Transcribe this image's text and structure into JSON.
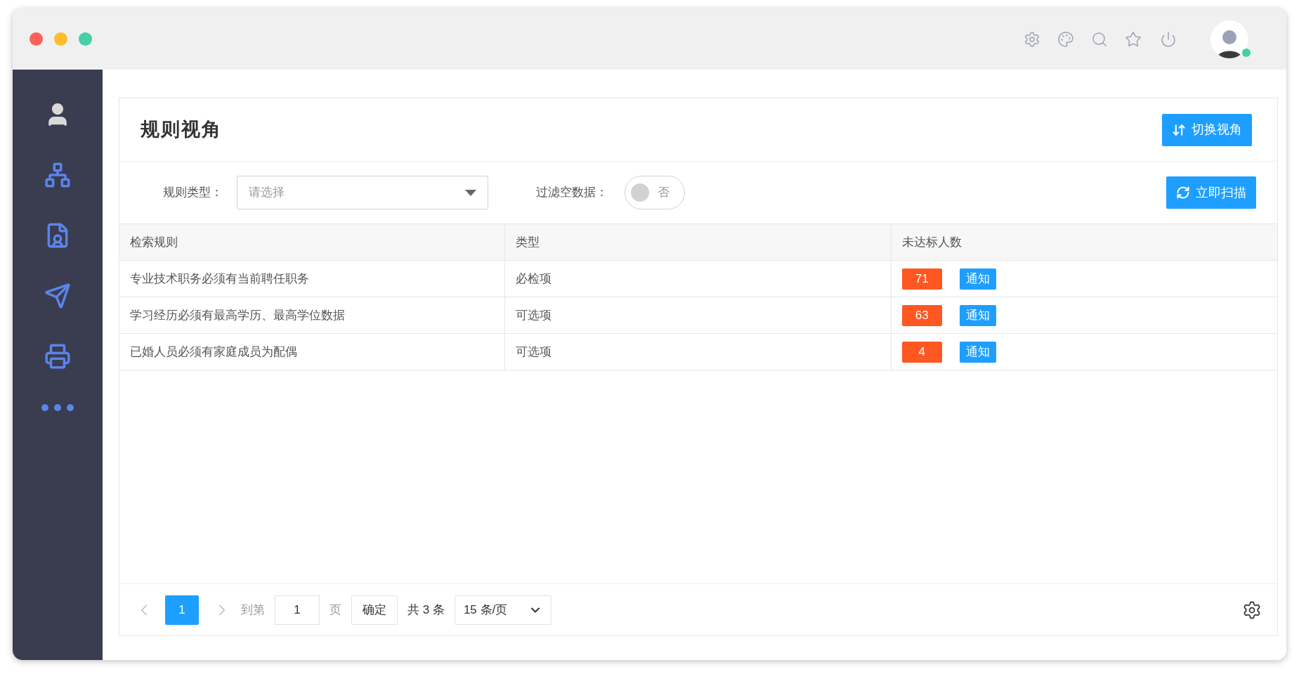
{
  "user": {
    "online": true
  },
  "sidebar": {
    "items": [
      {
        "kind": "user"
      },
      {
        "kind": "org"
      },
      {
        "kind": "doc"
      },
      {
        "kind": "send"
      },
      {
        "kind": "print"
      },
      {
        "kind": "more"
      }
    ]
  },
  "page": {
    "title": "规则视角",
    "switch_button": "切换视角"
  },
  "filters": {
    "rule_type": {
      "label": "规则类型：",
      "placeholder": "请选择"
    },
    "filter_empty": {
      "label": "过滤空数据：",
      "on": false,
      "text": "否"
    },
    "scan_button": "立即扫描"
  },
  "table": {
    "columns": [
      "检索规则",
      "类型",
      "未达标人数"
    ],
    "rows": [
      {
        "rule": "专业技术职务必须有当前聘任职务",
        "type": "必检项",
        "count": "71",
        "action": "通知"
      },
      {
        "rule": "学习经历必须有最高学历、最高学位数据",
        "type": "可选项",
        "count": "63",
        "action": "通知"
      },
      {
        "rule": "已婚人员必须有家庭成员为配偶",
        "type": "可选项",
        "count": "4",
        "action": "通知"
      }
    ]
  },
  "pagination": {
    "pages": [
      {
        "label": "1",
        "selected": true
      }
    ],
    "goto_label": "到第",
    "goto_value": "1",
    "page_unit": "页",
    "confirm": "确定",
    "total": "共 3 条",
    "page_size": "15 条/页"
  }
}
